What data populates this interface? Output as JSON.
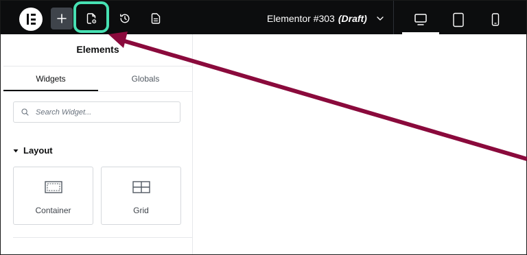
{
  "topbar": {
    "logo_icon": "elementor-logo-icon",
    "add_button_icon": "plus-icon",
    "page_settings_icon": "page-settings-icon",
    "history_icon": "history-icon",
    "structure_icon": "structure-document-icon",
    "highlight_color": "#47e1b3"
  },
  "document": {
    "name": "Elementor #303",
    "status": "(Draft)"
  },
  "devices": [
    {
      "name": "Desktop",
      "icon": "desktop-icon",
      "active": true
    },
    {
      "name": "Tablet",
      "icon": "tablet-icon",
      "active": false
    },
    {
      "name": "Mobile",
      "icon": "mobile-icon",
      "active": false
    }
  ],
  "panel": {
    "title": "Elements",
    "tabs": [
      {
        "label": "Widgets",
        "active": true
      },
      {
        "label": "Globals",
        "active": false
      }
    ],
    "search_placeholder": "Search Widget...",
    "category": "Layout",
    "widgets": [
      {
        "label": "Container",
        "icon": "container-icon"
      },
      {
        "label": "Grid",
        "icon": "grid-icon"
      }
    ]
  },
  "annotation": {
    "type": "arrow",
    "color": "#8a0a3c"
  }
}
